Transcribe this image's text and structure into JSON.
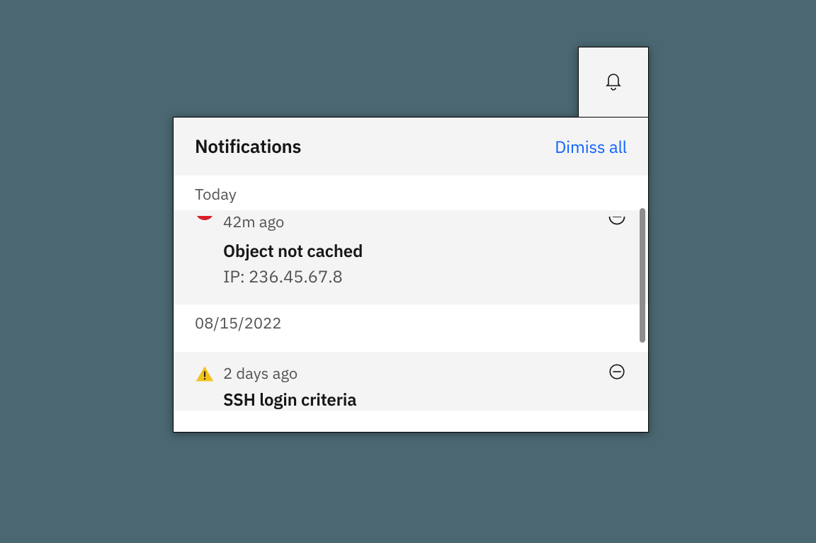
{
  "header": {
    "title": "Notifications",
    "dismiss_all_label": "Dimiss all"
  },
  "groups": [
    {
      "date_label": "Today",
      "items": [
        {
          "icon": "error-icon",
          "time": "42m ago",
          "title": "Object not cached",
          "subtitle": "IP: 236.45.67.8"
        }
      ]
    },
    {
      "date_label": "08/15/2022",
      "items": [
        {
          "icon": "warning-icon",
          "time": "2 days ago",
          "title": "SSH login criteria",
          "subtitle": ""
        }
      ]
    }
  ],
  "icons": {
    "bell": "bell-icon",
    "dismiss": "subtract-icon"
  },
  "colors": {
    "link": "#0f62fe",
    "error": "#da1e28",
    "warning": "#f1c21b"
  }
}
